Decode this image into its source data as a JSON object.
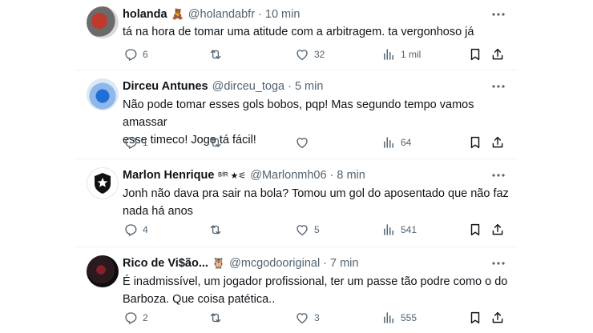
{
  "tweets": [
    {
      "name": "holanda",
      "emoji": "🧸",
      "handle": "@holandabfr",
      "time": "10 min",
      "text_lines": [
        "tá na hora de tomar uma atitude com a arbitragem. ta vergonhoso já"
      ],
      "replies": "6",
      "reposts": "",
      "likes": "32",
      "views": "1 mil"
    },
    {
      "name": "Dirceu Antunes",
      "emoji": "",
      "handle": "@dirceu_toga",
      "time": "5 min",
      "text_lines": [
        "Não pode tomar esses gols bobos, pqp! Mas segundo tempo vamos amassar",
        "esse timeco! Jogo tá fácil!"
      ],
      "replies": "1",
      "reposts": "",
      "likes": "",
      "views": "64"
    },
    {
      "name": "Marlon Henrique",
      "emoji": "ᴮᶠᴿ ★⚟",
      "handle": "@Marlonmh06",
      "time": "8 min",
      "text_lines": [
        "Jonh não dava pra sair na bola? Tomou um gol do aposentado que não faz",
        "nada há anos"
      ],
      "replies": "4",
      "reposts": "",
      "likes": "5",
      "views": "541"
    },
    {
      "name": "Rico de Vi$ão...",
      "emoji": "🦉",
      "handle": "@mcgodooriginal",
      "time": "7 min",
      "text_lines": [
        "É inadmissível, um jogador profissional, ter um passe tão podre como o do",
        "Barboza. Que coisa patética.."
      ],
      "replies": "2",
      "reposts": "",
      "likes": "3",
      "views": "555"
    }
  ],
  "colors": {
    "text": "#0f1419",
    "secondary": "#536471",
    "divider": "#eff3f4"
  },
  "icons": [
    "more-icon",
    "reply-icon",
    "repost-icon",
    "like-icon",
    "views-icon",
    "bookmark-icon",
    "share-icon"
  ]
}
